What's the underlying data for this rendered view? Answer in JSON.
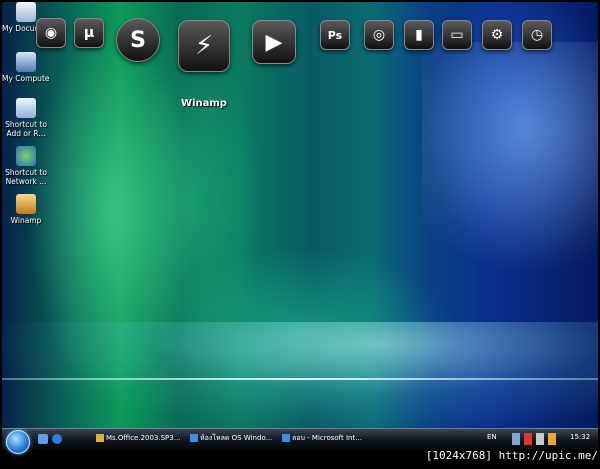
{
  "desktop_icons": [
    {
      "label": "My Documents",
      "icon": "folder-documents-icon"
    },
    {
      "label": "My Computer",
      "icon": "computer-icon"
    },
    {
      "label": "Shortcut to Add or R...",
      "icon": "control-panel-icon"
    },
    {
      "label": "Shortcut to Network ...",
      "icon": "network-icon"
    },
    {
      "label": "Winamp",
      "icon": "winamp-icon"
    }
  ],
  "dock": {
    "hover_label": "Winamp",
    "items": [
      {
        "name": "firefox",
        "glyph": "◉"
      },
      {
        "name": "utorrent",
        "glyph": "µ"
      },
      {
        "name": "skype",
        "glyph": "S"
      },
      {
        "name": "winamp",
        "glyph": "⚡"
      },
      {
        "name": "media-player",
        "glyph": "▶"
      },
      {
        "name": "photoshop",
        "glyph": "Ps"
      },
      {
        "name": "disc",
        "glyph": "◎"
      },
      {
        "name": "book",
        "glyph": "▮"
      },
      {
        "name": "monitor",
        "glyph": "▭"
      },
      {
        "name": "settings",
        "glyph": "⚙"
      },
      {
        "name": "clock",
        "glyph": "◷"
      }
    ]
  },
  "taskbar": {
    "tasks": [
      {
        "label": "Ms.Office.2003.SP3..."
      },
      {
        "label": "ห้องโหลด OS Windo..."
      },
      {
        "label": "ลอบ - Microsoft Int..."
      }
    ],
    "language": "EN",
    "clock": "15:32"
  },
  "caption": "[1024x768] http://upic.me/"
}
